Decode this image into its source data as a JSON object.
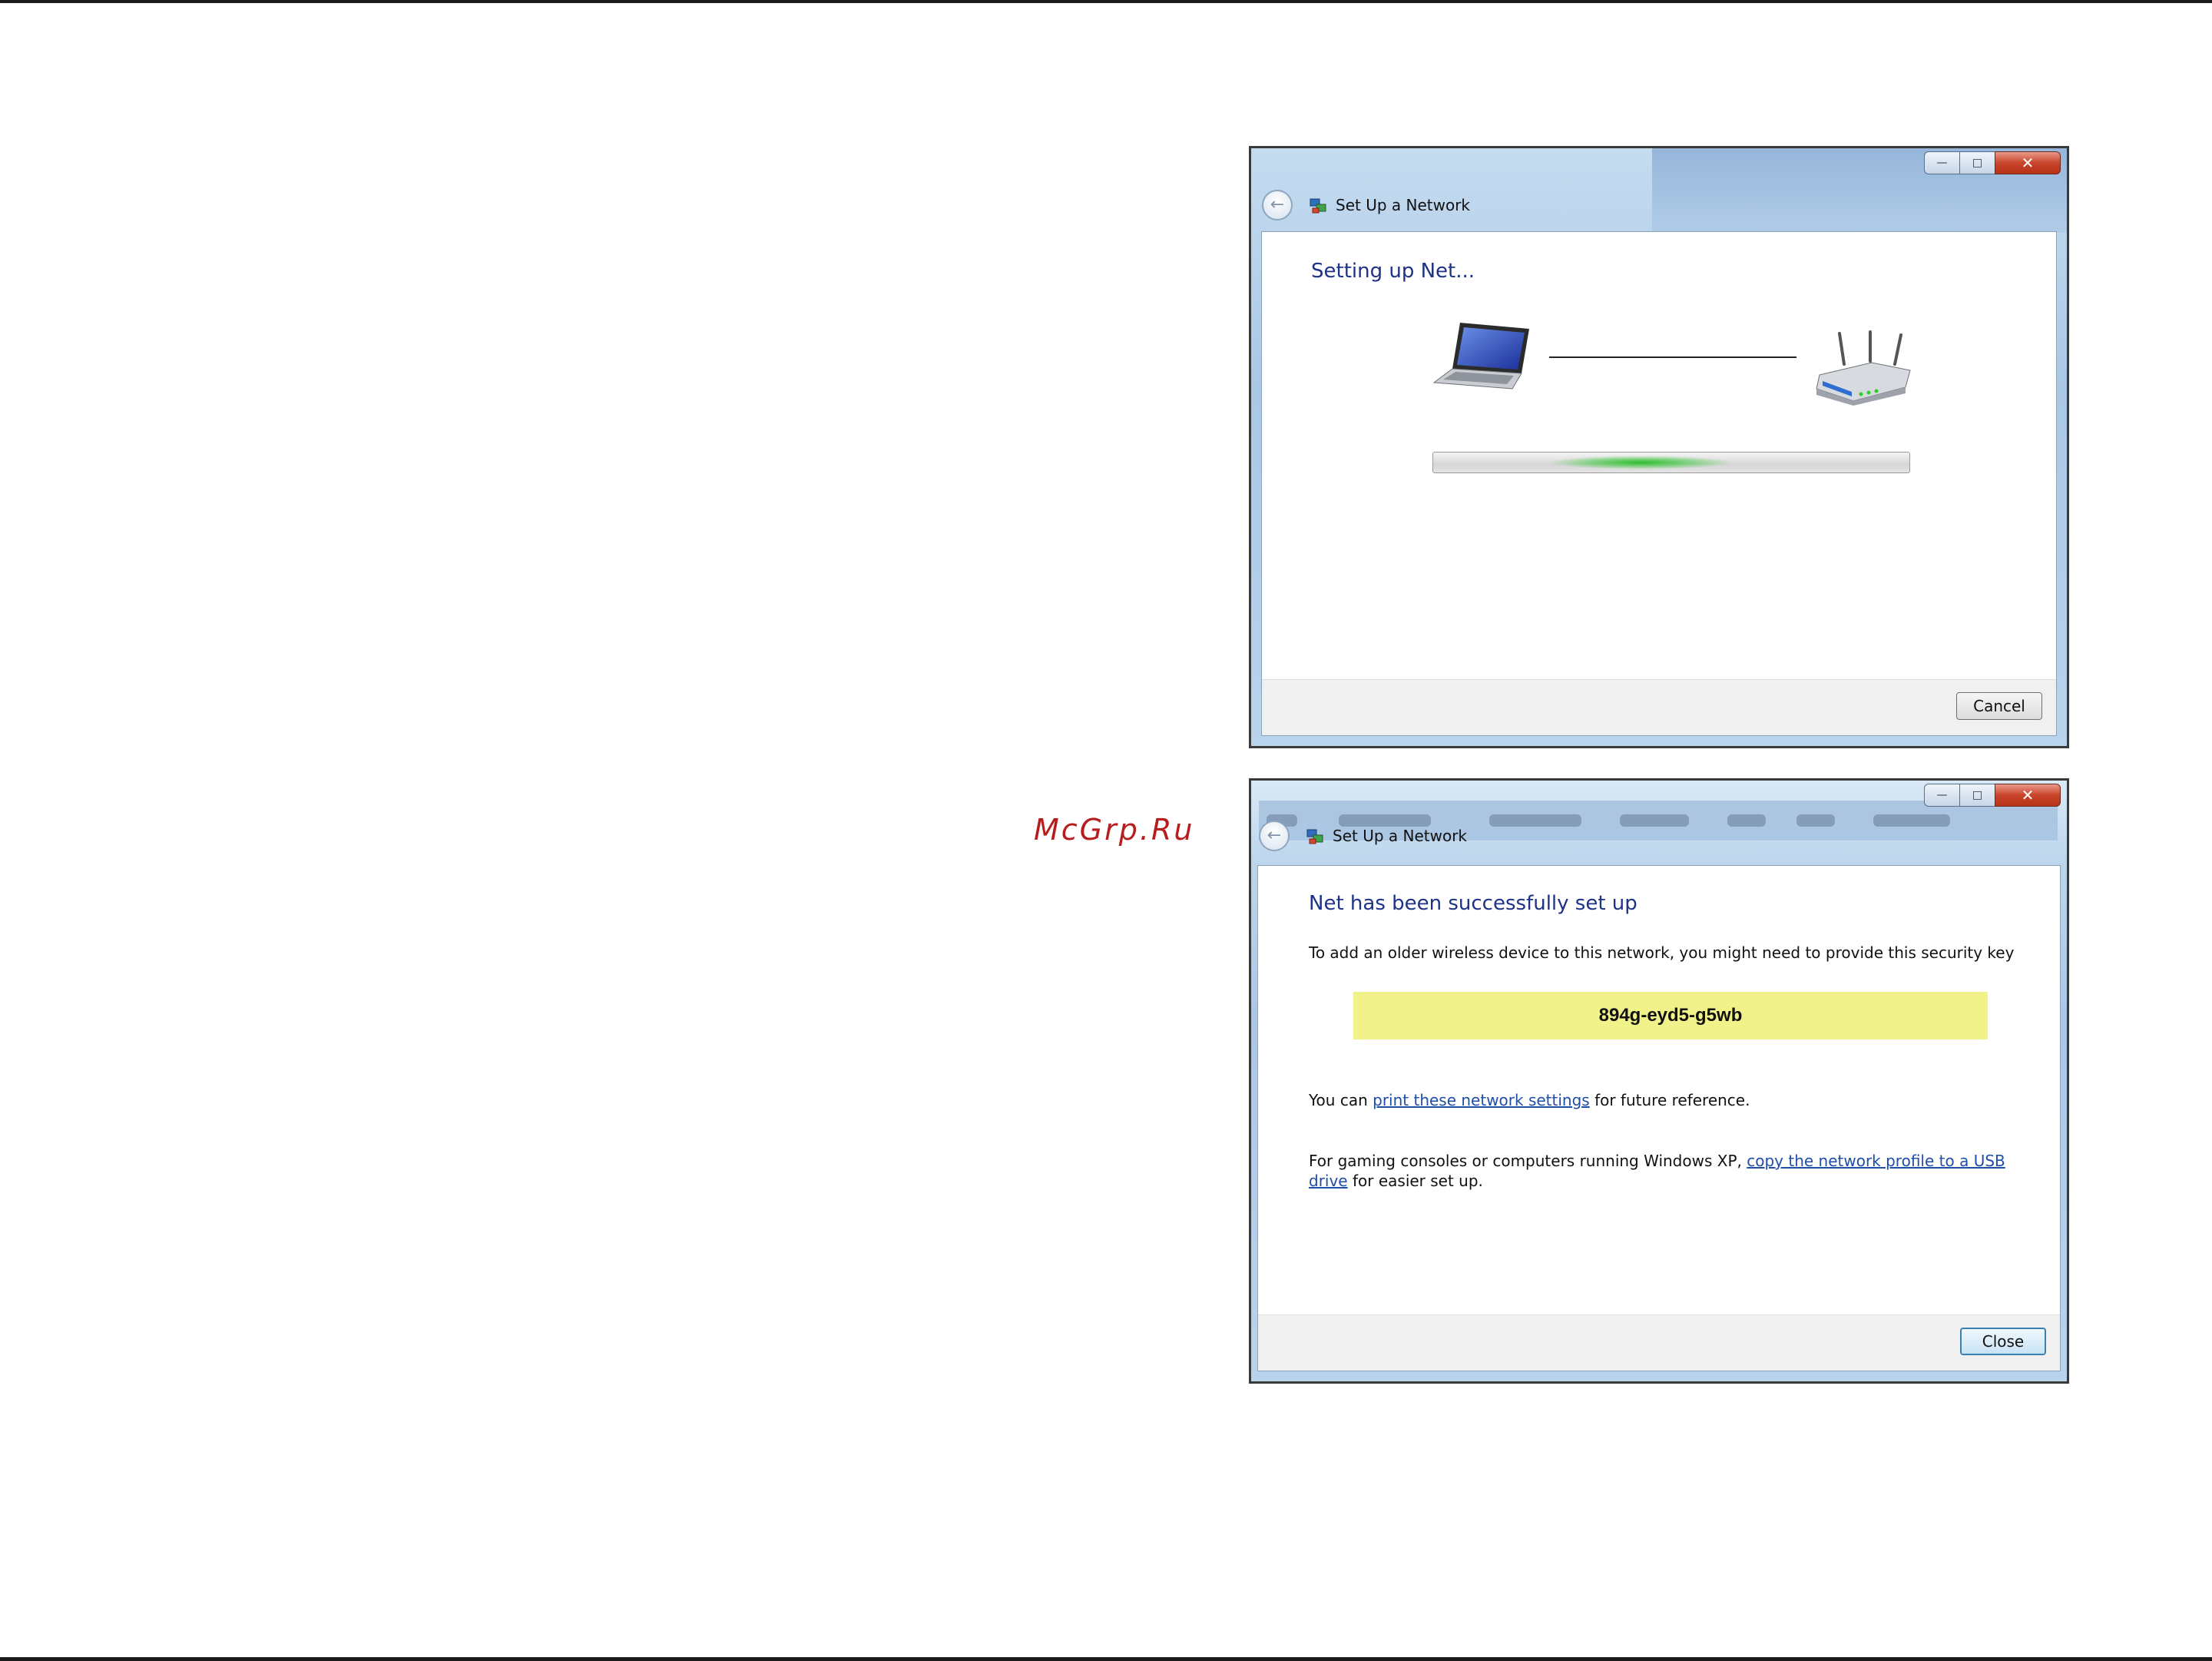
{
  "watermark": "McGrp.Ru",
  "window_setup": {
    "title": "Set Up a Network",
    "heading": "Setting up Net...",
    "progress_state": "indeterminate",
    "cancel_label": "Cancel"
  },
  "window_success": {
    "title": "Set Up a Network",
    "heading": "Net has been successfully set up",
    "intro": "To add an older wireless device to this network, you might need to provide this security key",
    "security_key": "894g-eyd5-g5wb",
    "print_prefix": "You can ",
    "print_link": "print these network settings",
    "print_suffix": " for future reference.",
    "usb_prefix": "For gaming consoles or computers running Windows XP, ",
    "usb_link": "copy the network profile to a USB drive",
    "usb_suffix": " for easier set up.",
    "close_label": "Close"
  },
  "icons": {
    "back": "back-arrow-icon",
    "title": "network-setup-icon",
    "laptop": "laptop-icon",
    "router": "router-icon"
  },
  "colors": {
    "heading": "#1e3287",
    "link": "#1f4ea8",
    "key_highlight": "#f2f28a",
    "progress": "#2ebd2e",
    "close_button_red": "#c8442a"
  }
}
